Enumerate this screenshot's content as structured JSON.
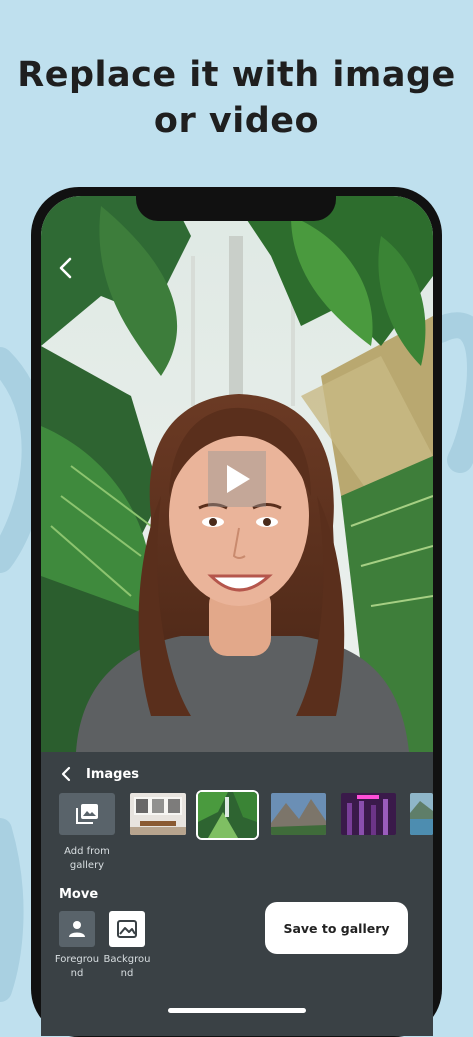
{
  "headline": {
    "line1": "Replace it with image",
    "line2": "or video"
  },
  "icons": {
    "back": "chevron-left-icon",
    "play": "play-icon",
    "gallery": "image-stack-icon",
    "foreground": "person-icon",
    "background": "landscape-icon"
  },
  "editor": {
    "panel_title": "Images",
    "add_from_gallery_label": "Add from gallery",
    "thumbnails": [
      {
        "name": "office-interior",
        "selected": false
      },
      {
        "name": "jungle-greenhouse",
        "selected": true
      },
      {
        "name": "mountain-valley",
        "selected": false
      },
      {
        "name": "neon-forest",
        "selected": false
      },
      {
        "name": "lake-landscape",
        "selected": false
      }
    ],
    "move_title": "Move",
    "foreground_label": "Foreground",
    "background_label": "Background",
    "save_label": "Save to gallery"
  },
  "colors": {
    "page_background": "#bfe0ee",
    "panel_background": "#3a4145",
    "save_button": "#ffffff"
  }
}
